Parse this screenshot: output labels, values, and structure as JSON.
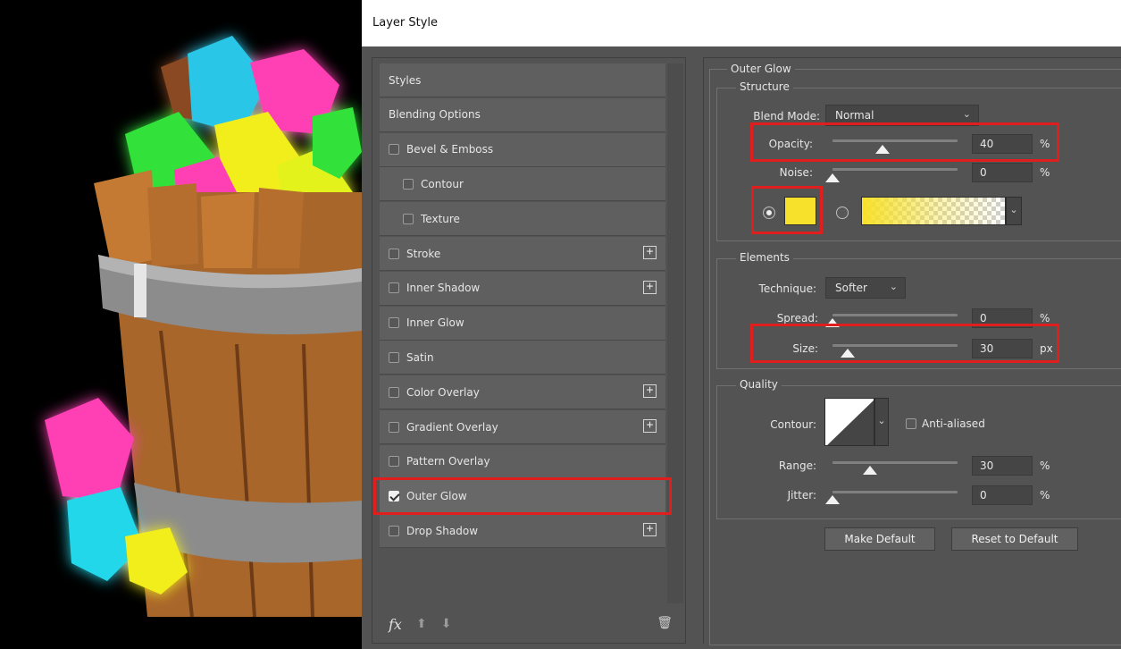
{
  "dialog": {
    "title": "Layer Style"
  },
  "styles_list": {
    "items": [
      {
        "label": "Styles",
        "kind": "header"
      },
      {
        "label": "Blending Options",
        "kind": "header"
      },
      {
        "label": "Bevel & Emboss",
        "checked": false
      },
      {
        "label": "Contour",
        "checked": false,
        "indent": true
      },
      {
        "label": "Texture",
        "checked": false,
        "indent": true
      },
      {
        "label": "Stroke",
        "checked": false,
        "plus": true
      },
      {
        "label": "Inner Shadow",
        "checked": false,
        "plus": true
      },
      {
        "label": "Inner Glow",
        "checked": false
      },
      {
        "label": "Satin",
        "checked": false
      },
      {
        "label": "Color Overlay",
        "checked": false,
        "plus": true
      },
      {
        "label": "Gradient Overlay",
        "checked": false,
        "plus": true
      },
      {
        "label": "Pattern Overlay",
        "checked": false
      },
      {
        "label": "Outer Glow",
        "checked": true,
        "active": true
      },
      {
        "label": "Drop Shadow",
        "checked": false,
        "plus": true
      }
    ],
    "plus_glyph": "+",
    "fx_label": "fx"
  },
  "outer_glow": {
    "section_title": "Outer Glow",
    "structure": {
      "title": "Structure",
      "blend_mode_label": "Blend Mode:",
      "blend_mode_value": "Normal",
      "opacity_label": "Opacity:",
      "opacity_value": "40",
      "opacity_unit": "%",
      "opacity_level": 0.4,
      "noise_label": "Noise:",
      "noise_value": "0",
      "noise_unit": "%",
      "noise_level": 0.0,
      "glow_color": "#f7e12a"
    },
    "elements": {
      "title": "Elements",
      "technique_label": "Technique:",
      "technique_value": "Softer",
      "spread_label": "Spread:",
      "spread_value": "0",
      "spread_unit": "%",
      "spread_level": 0.0,
      "size_label": "Size:",
      "size_value": "30",
      "size_unit": "px",
      "size_level": 0.12
    },
    "quality": {
      "title": "Quality",
      "contour_label": "Contour:",
      "anti_aliased_label": "Anti-aliased",
      "range_label": "Range:",
      "range_value": "30",
      "range_unit": "%",
      "range_level": 0.3,
      "jitter_label": "Jitter:",
      "jitter_value": "0",
      "jitter_unit": "%",
      "jitter_level": 0.0
    },
    "make_default_label": "Make Default",
    "reset_default_label": "Reset to Default"
  },
  "colors": {
    "dialog_bg": "#535353",
    "highlight_red": "#e01e1e",
    "glow_yellow": "#f7e12a"
  }
}
